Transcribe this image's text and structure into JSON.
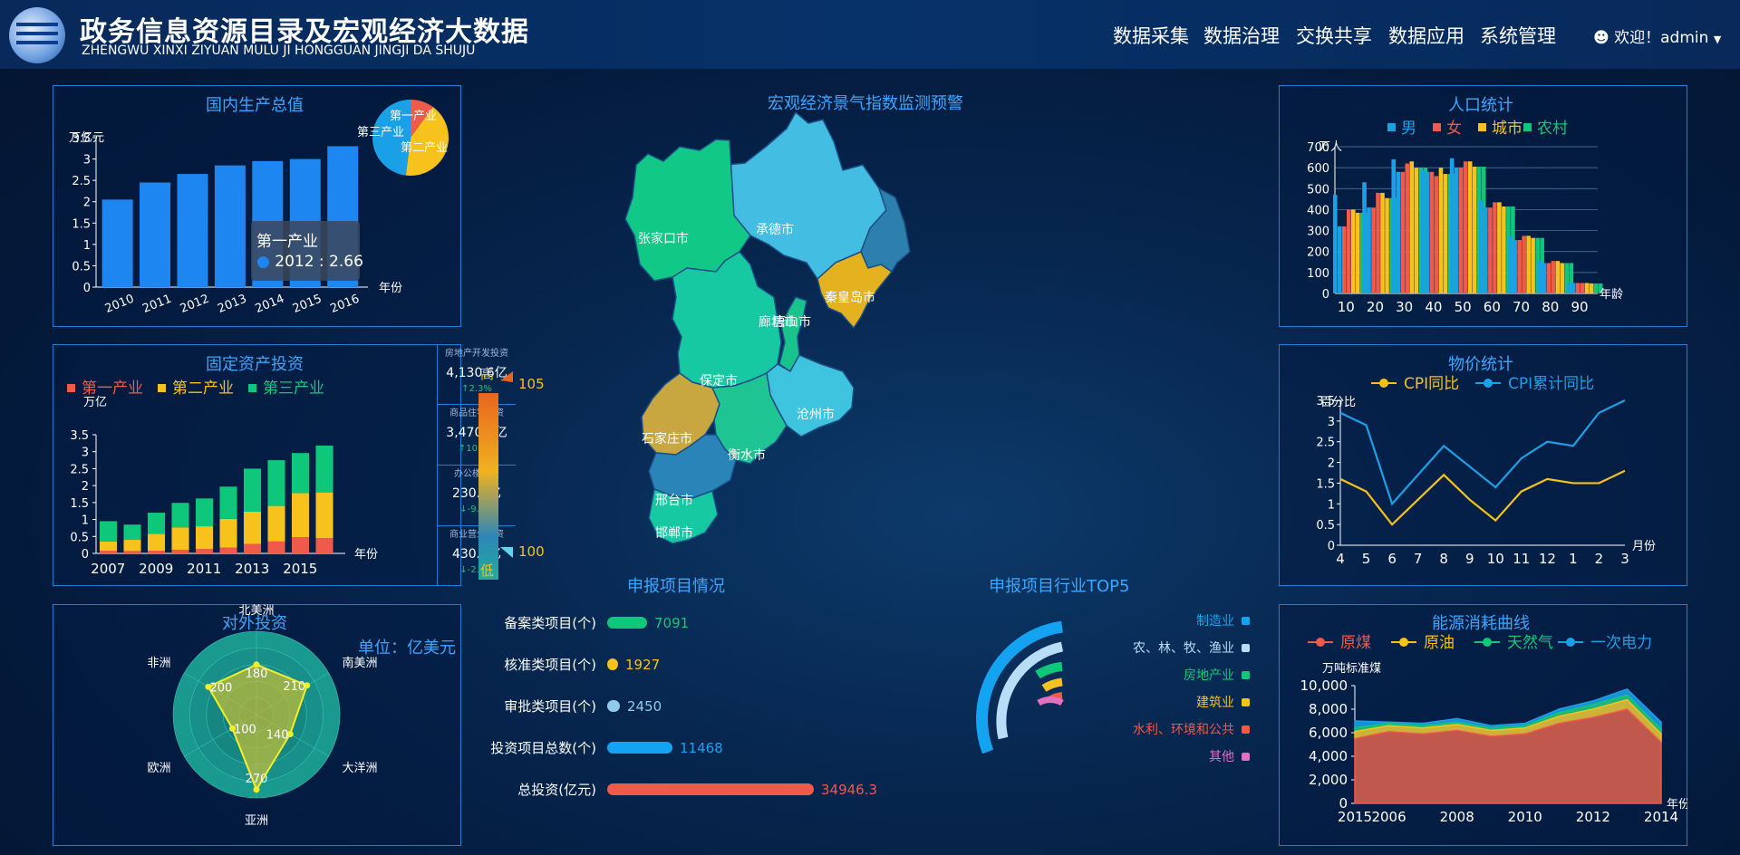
{
  "header": {
    "title": "政务信息资源目录及宏观经济大数据",
    "subtitle": "ZHENGWU XINXI ZIYUAN MULU JI HONGGUAN JINGJI DA SHUJU",
    "nav": [
      "数据采集",
      "数据治理",
      "交换共享",
      "数据应用",
      "系统管理"
    ],
    "welcome": "欢迎！admin"
  },
  "colors": {
    "blue": "#1d86f0",
    "red": "#ef5a4a",
    "yellow": "#f6c21b",
    "green": "#0fc77a",
    "cyan": "#1aa0e6"
  },
  "gdp": {
    "title": "国内生产总值",
    "tooltip": {
      "name": "第一产业",
      "text": "2012 : 2.66"
    }
  },
  "fixed": {
    "title": "固定资产投资",
    "boxes": [
      {
        "label": "房地产开发投资",
        "value": "4,130.6亿",
        "change": "↑2.3%"
      },
      {
        "label": "商品住宅投资",
        "value": "3,470.2亿",
        "change": "↑10.5%"
      },
      {
        "label": "办公楼投资",
        "value": "230.2亿",
        "change": "↓-9.3%"
      },
      {
        "label": "商业营业投资",
        "value": "430.2亿",
        "change": "↓-2.6%"
      }
    ]
  },
  "foreign": {
    "title": "对外投资",
    "unit": "单位：亿美元"
  },
  "map": {
    "title": "宏观经济景气指数监测预警",
    "high": "高",
    "low": "低",
    "max": "105",
    "min": "100",
    "cities": [
      "张家口市",
      "承德市",
      "秦皇岛市",
      "唐山市",
      "廊坊市",
      "保定市",
      "沧州市",
      "石家庄市",
      "衡水市",
      "邢台市",
      "邯郸市"
    ]
  },
  "projects": {
    "title": "申报项目情况",
    "items": [
      {
        "label": "备案类项目(个)",
        "value": "7091",
        "color": "#0fc77a"
      },
      {
        "label": "核准类项目(个)",
        "value": "1927",
        "color": "#f6c21b"
      },
      {
        "label": "审批类项目(个)",
        "value": "2450",
        "color": "#8fcbec"
      },
      {
        "label": "投资项目总数(个)",
        "value": "11468",
        "color": "#14a3f0"
      },
      {
        "label": "总投资(亿元)",
        "value": "34946.3",
        "color": "#ef5a4a"
      }
    ]
  },
  "top5": {
    "title": "申报项目行业TOP5",
    "items": [
      {
        "label": "制造业",
        "color": "#14a3f0"
      },
      {
        "label": "农、林、牧、渔业",
        "color": "#b8def7"
      },
      {
        "label": "房地产业",
        "color": "#0fc77a"
      },
      {
        "label": "建筑业",
        "color": "#f6c21b"
      },
      {
        "label": "水利、环境和公共",
        "color": "#ef5a4a"
      },
      {
        "label": "其他",
        "color": "#e070c0"
      }
    ]
  },
  "population": {
    "title": "人口统计"
  },
  "price": {
    "title": "物价统计"
  },
  "energy": {
    "title": "能源消耗曲线"
  },
  "chart_data": [
    {
      "type": "bar",
      "title": "国内生产总值",
      "categories": [
        "2010",
        "2011",
        "2012",
        "2013",
        "2014",
        "2015",
        "2016"
      ],
      "values": [
        2.05,
        2.45,
        2.65,
        2.85,
        2.95,
        3.0,
        3.3
      ],
      "ylabel": "万亿元",
      "xlabel": "年份",
      "ylim": [
        0,
        3.5
      ],
      "yticks": [
        "0",
        "0.5",
        "1",
        "1.5",
        "2",
        "2.5",
        "3",
        "3.5"
      ],
      "pie": {
        "labels": [
          "第一产业",
          "第二产业",
          "第三产业"
        ],
        "values": [
          10,
          42,
          48
        ]
      }
    },
    {
      "type": "bar",
      "title": "固定资产投资",
      "categories": [
        "2007",
        "2008",
        "2009",
        "2010",
        "2011",
        "2012",
        "2013",
        "2014",
        "2015",
        "2016"
      ],
      "xticks": [
        "2007",
        "2009",
        "2011",
        "2013",
        "2015"
      ],
      "ylabel": "万亿",
      "xlabel": "年份",
      "ylim": [
        0,
        3.5
      ],
      "yticks": [
        "0",
        "0.5",
        "1",
        "1.5",
        "2",
        "2.5",
        "3",
        "3.5"
      ],
      "series": [
        {
          "name": "第一产业",
          "values": [
            0.08,
            0.07,
            0.08,
            0.1,
            0.13,
            0.17,
            0.28,
            0.35,
            0.48,
            0.45
          ]
        },
        {
          "name": "第二产业",
          "values": [
            0.27,
            0.33,
            0.5,
            0.67,
            0.67,
            0.85,
            0.95,
            1.05,
            1.3,
            1.35
          ]
        },
        {
          "name": "第三产业",
          "values": [
            0.6,
            0.45,
            0.62,
            0.72,
            0.82,
            0.95,
            1.27,
            1.35,
            1.18,
            1.38
          ]
        }
      ]
    },
    {
      "type": "radar",
      "title": "对外投资",
      "indicators": [
        "北美洲",
        "南美洲",
        "大洋洲",
        "亚洲",
        "欧洲",
        "非洲"
      ],
      "values": [
        180,
        210,
        140,
        270,
        100,
        200
      ]
    },
    {
      "type": "bar",
      "title": "人口统计",
      "ylabel": "万人",
      "xlabel": "年龄",
      "categories": [
        "10",
        "20",
        "30",
        "40",
        "50",
        "60",
        "70",
        "80",
        "90"
      ],
      "ylim": [
        0,
        700
      ],
      "yticks": [
        "0",
        "100",
        "200",
        "300",
        "400",
        "500",
        "600",
        "700"
      ],
      "series": [
        {
          "name": "男",
          "values": [
            [
              470,
              320
            ],
            [
              530,
              410
            ],
            [
              640,
              580
            ],
            [
              590,
              580
            ],
            [
              645,
              600
            ],
            [
              445,
              410
            ],
            [
              275,
              255
            ],
            [
              155,
              145
            ],
            [
              50,
              50
            ]
          ]
        },
        {
          "name": "女",
          "values": [
            [
              320,
              400
            ],
            [
              410,
              480
            ],
            [
              580,
              620
            ],
            [
              580,
              560
            ],
            [
              600,
              630
            ],
            [
              410,
              435
            ],
            [
              255,
              275
            ],
            [
              145,
              155
            ],
            [
              50,
              50
            ]
          ]
        },
        {
          "name": "城市",
          "values": [
            [
              400,
              385
            ],
            [
              480,
              455
            ],
            [
              630,
              600
            ],
            [
              600,
              570
            ],
            [
              630,
              605
            ],
            [
              435,
              415
            ],
            [
              275,
              265
            ],
            [
              155,
              145
            ],
            [
              50,
              48
            ]
          ]
        },
        {
          "name": "农村",
          "values": [
            [
              385,
              385
            ],
            [
              455,
              455
            ],
            [
              600,
              600
            ],
            [
              570,
              570
            ],
            [
              605,
              605
            ],
            [
              415,
              415
            ],
            [
              265,
              265
            ],
            [
              145,
              145
            ],
            [
              48,
              48
            ]
          ]
        }
      ]
    },
    {
      "type": "line",
      "title": "物价统计",
      "ylabel": "百分比",
      "xlabel": "月份",
      "categories": [
        "4",
        "5",
        "6",
        "7",
        "8",
        "9",
        "10",
        "11",
        "12",
        "1",
        "2",
        "3"
      ],
      "ylim": [
        0,
        3.5
      ],
      "yticks": [
        "0",
        "0.5",
        "1",
        "1.5",
        "2",
        "2.5",
        "3",
        "3.5"
      ],
      "series": [
        {
          "name": "CPI同比",
          "values": [
            1.6,
            1.3,
            0.5,
            1.1,
            1.7,
            1.1,
            0.6,
            1.3,
            1.6,
            1.5,
            1.5,
            1.8
          ]
        },
        {
          "name": "CPI累计同比",
          "values": [
            3.2,
            2.9,
            1.0,
            1.7,
            2.4,
            1.9,
            1.4,
            2.1,
            2.5,
            2.4,
            3.2,
            3.5
          ]
        }
      ]
    },
    {
      "type": "area",
      "title": "能源消耗曲线",
      "ylabel": "万吨标准煤",
      "xlabel": "年份",
      "x": [
        "2015",
        "2006",
        "2007",
        "2008",
        "2009",
        "2010",
        "2011",
        "2012",
        "2013",
        "2014"
      ],
      "xticks": [
        "2015",
        "2006",
        "2008",
        "2010",
        "2012",
        "2014"
      ],
      "ylim": [
        0,
        10000
      ],
      "yticks": [
        "0",
        "2,000",
        "4,000",
        "6,000",
        "8,000",
        "10,000"
      ],
      "series": [
        {
          "name": "原煤",
          "values": [
            5500,
            6100,
            5900,
            6200,
            5700,
            5900,
            6800,
            7300,
            8000,
            5200
          ]
        },
        {
          "name": "原油",
          "values": [
            600,
            500,
            500,
            500,
            500,
            500,
            600,
            700,
            800,
            700
          ]
        },
        {
          "name": "天然气",
          "values": [
            300,
            200,
            200,
            200,
            200,
            200,
            300,
            400,
            400,
            400
          ]
        },
        {
          "name": "一次电力",
          "values": [
            600,
            100,
            200,
            300,
            200,
            200,
            300,
            300,
            500,
            600
          ]
        }
      ]
    }
  ]
}
